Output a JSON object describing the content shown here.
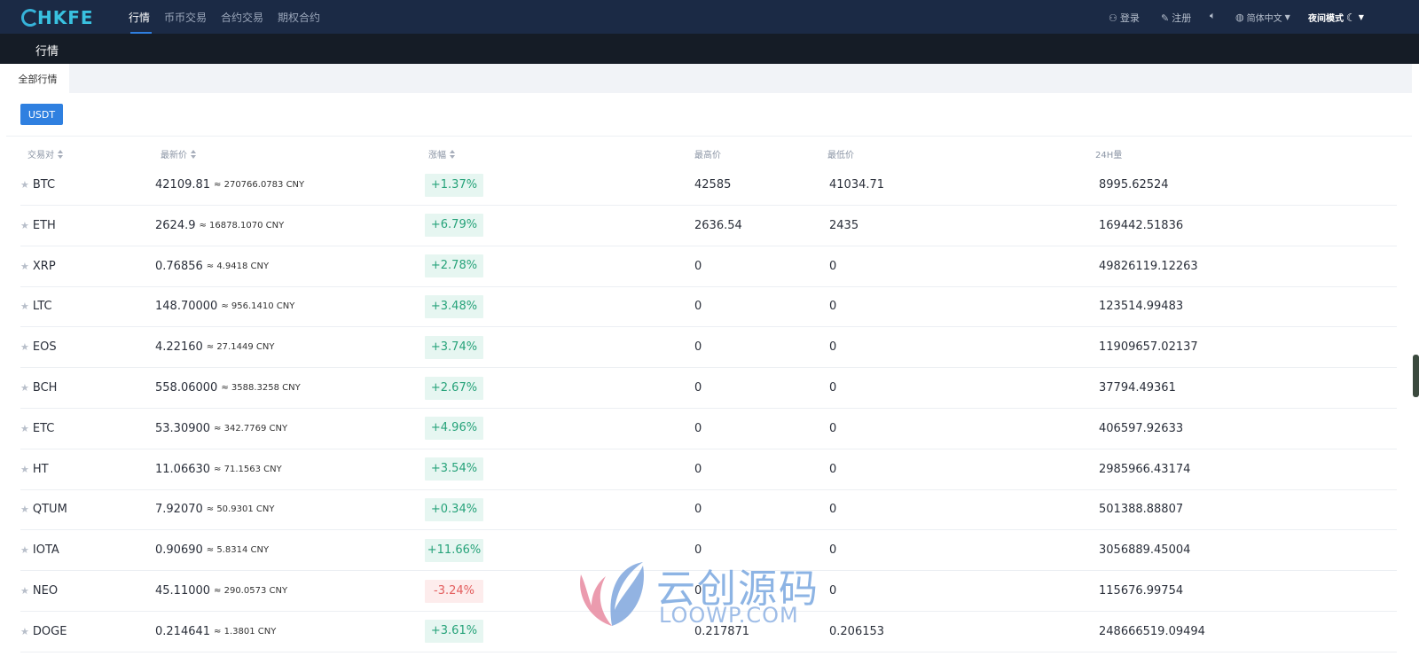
{
  "brand": {
    "logo_text": "HKFE"
  },
  "nav": {
    "items": [
      {
        "label": "行情",
        "active": true
      },
      {
        "label": "币币交易",
        "active": false
      },
      {
        "label": "合约交易",
        "active": false
      },
      {
        "label": "期权合约",
        "active": false
      }
    ],
    "login": "登录",
    "register": "注册",
    "language": "简体中文",
    "night_mode": "夜间模式"
  },
  "page_title": "行情",
  "tabs": [
    {
      "label": "全部行情",
      "active": true
    }
  ],
  "quote_button": "USDT",
  "table": {
    "headers": [
      "交易对",
      "最新价",
      "涨幅",
      "最高价",
      "最低价",
      "24H量"
    ],
    "rows": [
      {
        "pair": "BTC",
        "price": "42109.81",
        "cny": "≈ 270766.0783 CNY",
        "change": "+1.37%",
        "dir": "up",
        "high": "42585",
        "low": "41034.71",
        "volume": "8995.62524"
      },
      {
        "pair": "ETH",
        "price": "2624.9",
        "cny": "≈ 16878.1070 CNY",
        "change": "+6.79%",
        "dir": "up",
        "high": "2636.54",
        "low": "2435",
        "volume": "169442.51836"
      },
      {
        "pair": "XRP",
        "price": "0.76856",
        "cny": "≈ 4.9418 CNY",
        "change": "+2.78%",
        "dir": "up",
        "high": "0",
        "low": "0",
        "volume": "49826119.12263"
      },
      {
        "pair": "LTC",
        "price": "148.70000",
        "cny": "≈ 956.1410 CNY",
        "change": "+3.48%",
        "dir": "up",
        "high": "0",
        "low": "0",
        "volume": "123514.99483"
      },
      {
        "pair": "EOS",
        "price": "4.22160",
        "cny": "≈ 27.1449 CNY",
        "change": "+3.74%",
        "dir": "up",
        "high": "0",
        "low": "0",
        "volume": "11909657.02137"
      },
      {
        "pair": "BCH",
        "price": "558.06000",
        "cny": "≈ 3588.3258 CNY",
        "change": "+2.67%",
        "dir": "up",
        "high": "0",
        "low": "0",
        "volume": "37794.49361"
      },
      {
        "pair": "ETC",
        "price": "53.30900",
        "cny": "≈ 342.7769 CNY",
        "change": "+4.96%",
        "dir": "up",
        "high": "0",
        "low": "0",
        "volume": "406597.92633"
      },
      {
        "pair": "HT",
        "price": "11.06630",
        "cny": "≈ 71.1563 CNY",
        "change": "+3.54%",
        "dir": "up",
        "high": "0",
        "low": "0",
        "volume": "2985966.43174"
      },
      {
        "pair": "QTUM",
        "price": "7.92070",
        "cny": "≈ 50.9301 CNY",
        "change": "+0.34%",
        "dir": "up",
        "high": "0",
        "low": "0",
        "volume": "501388.88807"
      },
      {
        "pair": "IOTA",
        "price": "0.90690",
        "cny": "≈ 5.8314 CNY",
        "change": "+11.66%",
        "dir": "up",
        "high": "0",
        "low": "0",
        "volume": "3056889.45004"
      },
      {
        "pair": "NEO",
        "price": "45.11000",
        "cny": "≈ 290.0573 CNY",
        "change": "-3.24%",
        "dir": "down",
        "high": "0",
        "low": "0",
        "volume": "115676.99754"
      },
      {
        "pair": "DOGE",
        "price": "0.214641",
        "cny": "≈ 1.3801 CNY",
        "change": "+3.61%",
        "dir": "up",
        "high": "0.217871",
        "low": "0.206153",
        "volume": "248666519.09494"
      }
    ]
  },
  "watermark": {
    "cn": "云创源码",
    "en": "LOOWP.COM"
  },
  "colors": {
    "nav_bg": "#1b2a45",
    "accent": "#2f80e0",
    "up": "#27a37a",
    "down": "#e35d5d"
  }
}
